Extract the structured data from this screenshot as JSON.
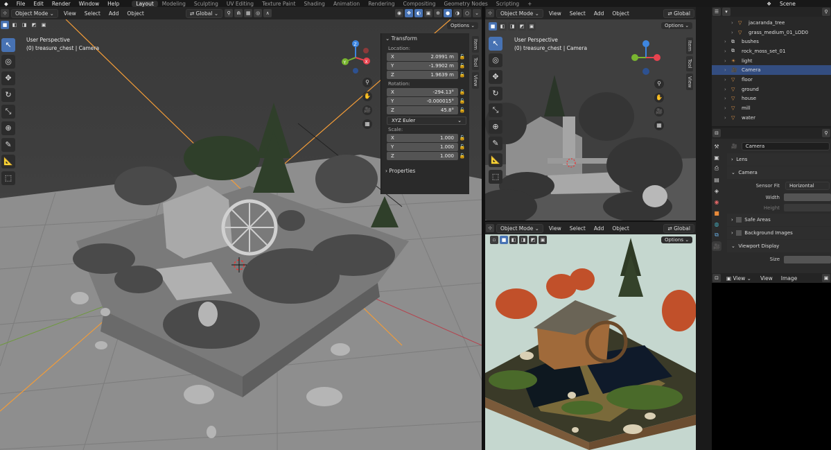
{
  "menubar": {
    "items": [
      "File",
      "Edit",
      "Render",
      "Window",
      "Help"
    ]
  },
  "workspaces": {
    "tabs": [
      "Layout",
      "Modeling",
      "Sculpting",
      "UV Editing",
      "Texture Paint",
      "Shading",
      "Animation",
      "Rendering",
      "Compositing",
      "Geometry Nodes",
      "Scripting"
    ],
    "add": "+"
  },
  "scene": {
    "name": "Scene"
  },
  "viewport_main": {
    "mode": "Object Mode",
    "menus": [
      "View",
      "Select",
      "Add",
      "Object"
    ],
    "orientation": "Global",
    "options": "Options",
    "overlay_line1": "User Perspective",
    "overlay_line2": "(0) treasure_chest | Camera",
    "gizmo": {
      "x": "X",
      "y": "Y",
      "z": "Z"
    },
    "side_tabs": [
      "Item",
      "Tool",
      "View"
    ]
  },
  "transform_panel": {
    "title": "Transform",
    "location_label": "Location:",
    "location": [
      {
        "axis": "X",
        "value": "2.0991 m"
      },
      {
        "axis": "Y",
        "value": "-1.9902 m"
      },
      {
        "axis": "Z",
        "value": "1.9639 m"
      }
    ],
    "rotation_label": "Rotation:",
    "rotation": [
      {
        "axis": "X",
        "value": "-294.13°"
      },
      {
        "axis": "Y",
        "value": "-0.000015°"
      },
      {
        "axis": "Z",
        "value": "45.8°"
      }
    ],
    "rotation_mode": "XYZ Euler",
    "scale_label": "Scale:",
    "scale": [
      {
        "axis": "X",
        "value": "1.000"
      },
      {
        "axis": "Y",
        "value": "1.000"
      },
      {
        "axis": "Z",
        "value": "1.000"
      }
    ],
    "properties_label": "Properties"
  },
  "viewport_top_right": {
    "mode": "Object Mode",
    "menus": [
      "View",
      "Select",
      "Add",
      "Object"
    ],
    "orientation": "Global",
    "options": "Options",
    "overlay_line1": "User Perspective",
    "overlay_line2": "(0) treasure_chest | Camera",
    "side_tabs": [
      "Item",
      "Tool",
      "View"
    ]
  },
  "viewport_render": {
    "mode": "Object Mode",
    "menus": [
      "View",
      "Select",
      "Add",
      "Object"
    ],
    "orientation": "Global",
    "options": "Options"
  },
  "outliner": {
    "items": [
      {
        "name": "jacaranda_tree",
        "indent": 2,
        "icon": "mesh-icon"
      },
      {
        "name": "grass_medium_01_LOD0",
        "indent": 2,
        "icon": "mesh-icon"
      },
      {
        "name": "bushes",
        "indent": 1,
        "icon": "collection-icon"
      },
      {
        "name": "rock_moss_set_01",
        "indent": 1,
        "icon": "collection-icon"
      },
      {
        "name": "light",
        "indent": 1,
        "icon": "light-icon"
      },
      {
        "name": "Camera",
        "indent": 1,
        "icon": "camera-icon",
        "selected": true
      },
      {
        "name": "floor",
        "indent": 1,
        "icon": "mesh-icon"
      },
      {
        "name": "ground",
        "indent": 1,
        "icon": "mesh-icon"
      },
      {
        "name": "house",
        "indent": 1,
        "icon": "mesh-icon"
      },
      {
        "name": "mill",
        "indent": 1,
        "icon": "mesh-icon"
      },
      {
        "name": "water",
        "indent": 1,
        "icon": "mesh-icon"
      }
    ]
  },
  "properties": {
    "object_name": "Camera",
    "sections": {
      "lens": "Lens",
      "camera": "Camera",
      "safe_areas": "Safe Areas",
      "background_images": "Background Images",
      "viewport_display": "Viewport Display"
    },
    "sensor_fit_label": "Sensor Fit",
    "sensor_fit_value": "Horizontal",
    "width_label": "Width",
    "height_label": "Height",
    "size_label": "Size"
  },
  "image_editor": {
    "view_menu": "View",
    "view2": "View",
    "image": "Image"
  },
  "colors": {
    "accent": "#4772b3",
    "selected_row": "#334d80",
    "axis_x": "#e8434f",
    "axis_y": "#79b530",
    "axis_z": "#3e86e0",
    "camera_line": "#f39c38"
  }
}
